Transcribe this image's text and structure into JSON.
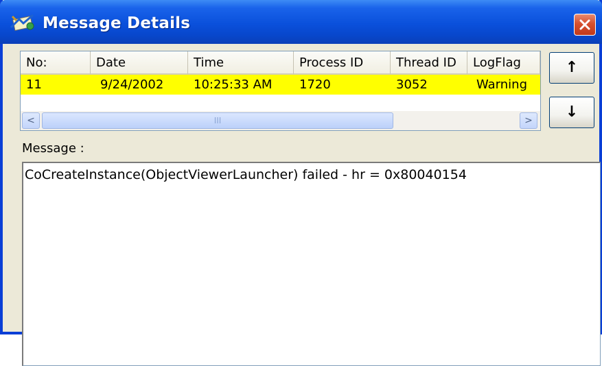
{
  "window": {
    "title": "Message Details",
    "close_label": "X"
  },
  "icons": {
    "app": "message-details-icon",
    "close": "close-icon",
    "up": "arrow-up-icon",
    "down": "arrow-down-icon"
  },
  "list": {
    "columns": [
      "No:",
      "Date",
      "Time",
      "Process ID",
      "Thread ID",
      "LogFlag"
    ],
    "rows": [
      {
        "no": "11",
        "date": "9/24/2002",
        "time": "10:25:33 AM",
        "process_id": "1720",
        "thread_id": "3052",
        "logflag": "Warning"
      }
    ],
    "selected_row_color": "#ffff00"
  },
  "scrollbar": {
    "left_glyph": "<",
    "right_glyph": ">",
    "thumb_grip": "III"
  },
  "nav": {
    "up_glyph": "↑",
    "down_glyph": "↓"
  },
  "message": {
    "label": "Message :",
    "text": "CoCreateInstance(ObjectViewerLauncher) failed - hr = 0x80040154"
  },
  "colors": {
    "titlebar": "#0a50db",
    "dialog_bg": "#ece9d8",
    "close_button": "#d6502f"
  }
}
